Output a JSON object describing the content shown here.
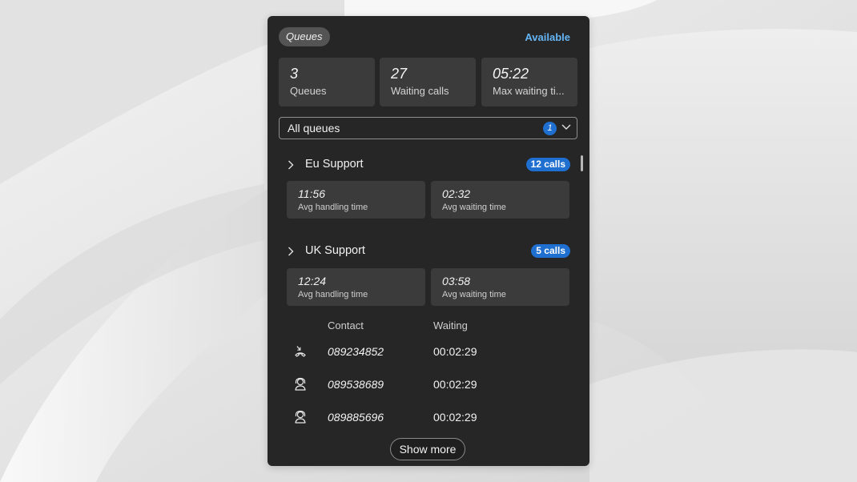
{
  "header": {
    "pill_label": "Queues",
    "status": "Available"
  },
  "stats": [
    {
      "value": "3",
      "label": "Queues"
    },
    {
      "value": "27",
      "label": "Waiting calls"
    },
    {
      "value": "05:22",
      "label": "Max waiting ti..."
    }
  ],
  "filter": {
    "selected": "All queues",
    "count": "1"
  },
  "queues": [
    {
      "name": "Eu Support",
      "calls": "12 calls",
      "avg_handling": {
        "value": "11:56",
        "label": "Avg handling time"
      },
      "avg_waiting": {
        "value": "02:32",
        "label": "Avg waiting time"
      }
    },
    {
      "name": "UK Support",
      "calls": "5 calls",
      "avg_handling": {
        "value": "12:24",
        "label": "Avg handling time"
      },
      "avg_waiting": {
        "value": "03:58",
        "label": "Avg waiting time"
      }
    }
  ],
  "contacts_table": {
    "headers": {
      "contact": "Contact",
      "waiting": "Waiting"
    },
    "rows": [
      {
        "icon": "callback-icon",
        "contact": "089234852",
        "waiting": "00:02:29"
      },
      {
        "icon": "agent-icon",
        "contact": "089538689",
        "waiting": "00:02:29"
      },
      {
        "icon": "agent-icon",
        "contact": "089885696",
        "waiting": "00:02:29"
      }
    ]
  },
  "show_more_label": "Show more",
  "colors": {
    "panel_bg": "#262626",
    "card_bg": "#3b3b3b",
    "accent": "#1f6fd0",
    "status_text": "#64b5f6"
  }
}
